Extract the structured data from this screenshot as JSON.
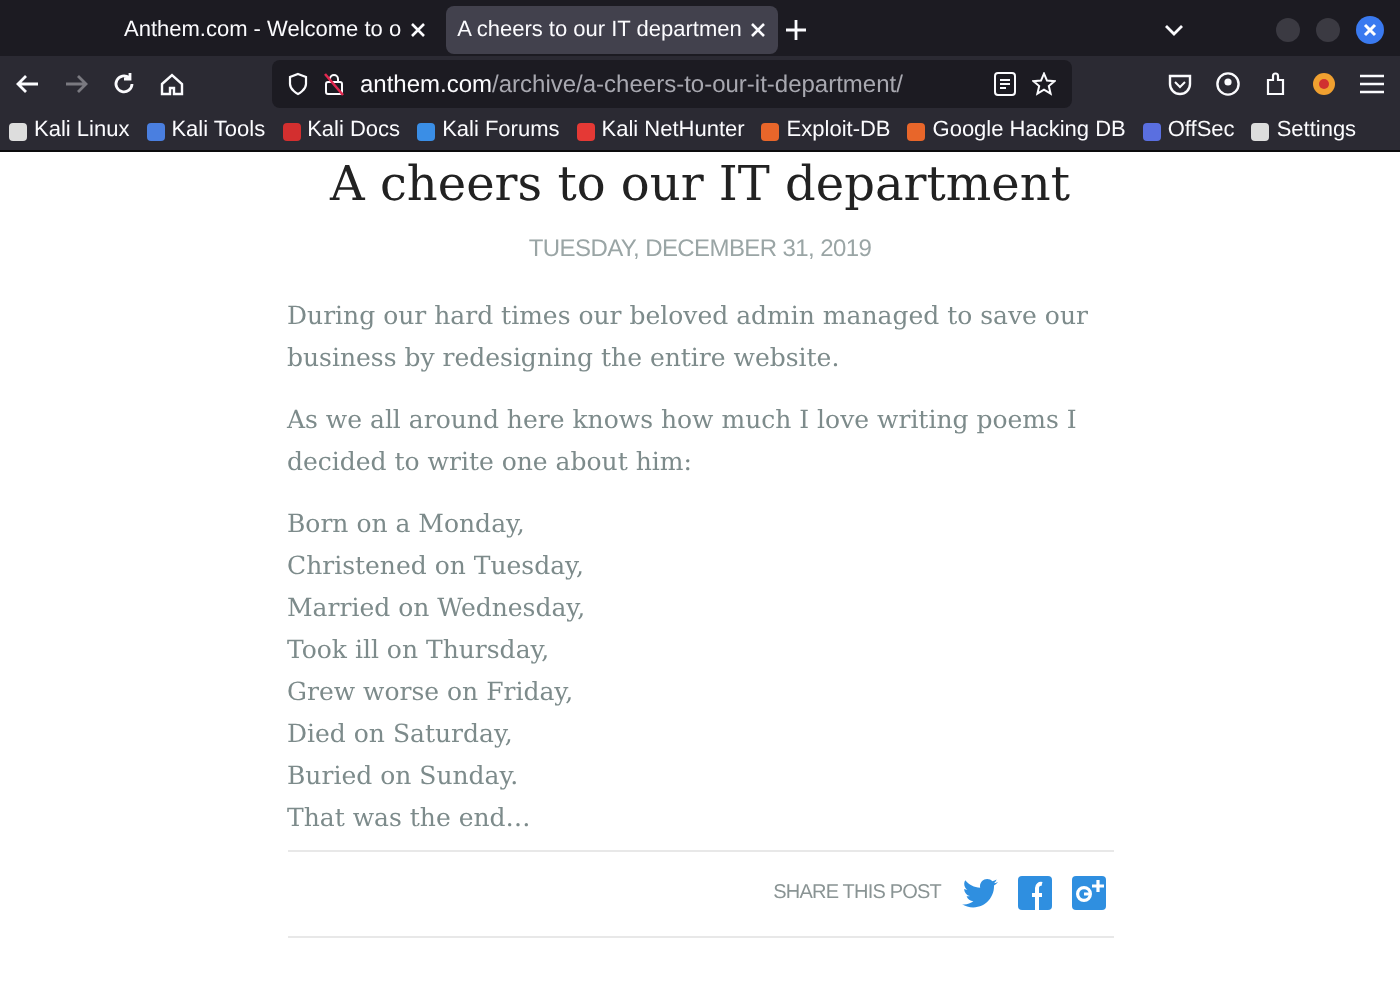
{
  "tabs": [
    {
      "title": "Anthem.com - Welcome to o",
      "selected": false
    },
    {
      "title": "A cheers to our IT departmen",
      "selected": true
    }
  ],
  "url": {
    "host": "anthem.com",
    "path": "/archive/a-cheers-to-our-it-department/"
  },
  "bookmarks": [
    {
      "label": "Kali Linux",
      "color": "#dddddd"
    },
    {
      "label": "Kali Tools",
      "color": "#4a7fe0"
    },
    {
      "label": "Kali Docs",
      "color": "#d32f2f"
    },
    {
      "label": "Kali Forums",
      "color": "#3a8ee6"
    },
    {
      "label": "Kali NetHunter",
      "color": "#e53935"
    },
    {
      "label": "Exploit-DB",
      "color": "#e8662a"
    },
    {
      "label": "Google Hacking DB",
      "color": "#e8662a"
    },
    {
      "label": "OffSec",
      "color": "#5a6fe0"
    },
    {
      "label": "Settings",
      "color": "#dddddd"
    }
  ],
  "article": {
    "title": "A cheers to our IT department",
    "date": "TUESDAY, DECEMBER 31, 2019",
    "paragraphs": [
      "During our hard times our beloved admin managed to save our business by redesigning the entire website.",
      "As we all around here knows how much I love writing poems I decided to write one about him:"
    ],
    "poem": [
      "Born on a Monday,",
      "Christened on Tuesday,",
      "Married on Wednesday,",
      "Took ill on Thursday,",
      "Grew worse on Friday,",
      "Died on Saturday,",
      "Buried on Sunday.",
      "That was the end…"
    ],
    "share_label": "SHARE THIS POST"
  }
}
